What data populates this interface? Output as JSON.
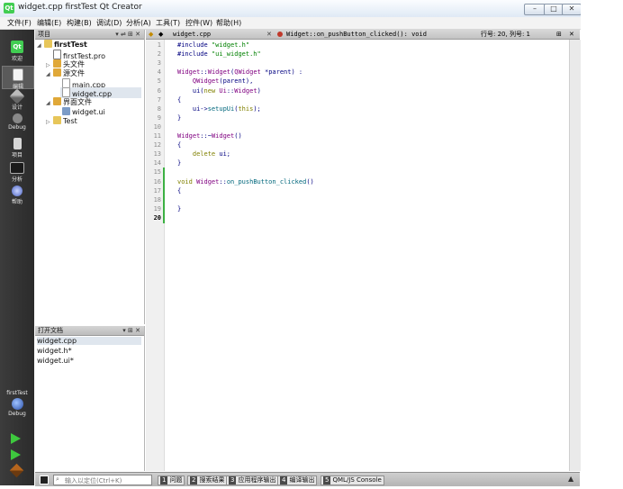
{
  "window": {
    "title": "widget.cpp   firstTest   Qt Creator",
    "app_icon": "Qt"
  },
  "menubar": [
    "文件(F)",
    "编辑(E)",
    "构建(B)",
    "调试(D)",
    "分析(A)",
    "工具(T)",
    "控件(W)",
    "帮助(H)"
  ],
  "modes": [
    {
      "label": "欢迎",
      "icon": "qt-logo-icon"
    },
    {
      "label": "编辑",
      "icon": "edit-document-icon"
    },
    {
      "label": "设计",
      "icon": "design-pen-icon"
    },
    {
      "label": "Debug",
      "icon": "debug-bug-icon"
    },
    {
      "label": "项目",
      "icon": "project-wrench-icon"
    },
    {
      "label": "分析",
      "icon": "analyze-monitor-icon"
    },
    {
      "label": "帮助",
      "icon": "help-icon"
    }
  ],
  "kit": {
    "project": "firstTest",
    "build": "Debug"
  },
  "project_panel": {
    "header": "项目",
    "tree": [
      {
        "label": "firstTest",
        "level": 0,
        "expanded": true,
        "icon": "project-folder-icon",
        "bold": true
      },
      {
        "label": "firstTest.pro",
        "level": 1,
        "icon": "pro-file-icon"
      },
      {
        "label": "头文件",
        "level": 1,
        "expanded": false,
        "icon": "headers-folder-icon"
      },
      {
        "label": "源文件",
        "level": 1,
        "expanded": true,
        "icon": "sources-folder-icon"
      },
      {
        "label": "main.cpp",
        "level": 2,
        "icon": "cpp-file-icon"
      },
      {
        "label": "widget.cpp",
        "level": 2,
        "icon": "cpp-file-icon",
        "selected": true
      },
      {
        "label": "界面文件",
        "level": 1,
        "expanded": true,
        "icon": "forms-folder-icon"
      },
      {
        "label": "widget.ui",
        "level": 2,
        "icon": "ui-file-icon"
      },
      {
        "label": "Test",
        "level": 0,
        "expanded": false,
        "icon": "project-folder-icon"
      }
    ]
  },
  "open_docs": {
    "header": "打开文档",
    "items": [
      "widget.cpp",
      "widget.h*",
      "widget.ui*"
    ]
  },
  "editor_toolbar": {
    "file": "widget.cpp",
    "symbol": "Widget::on_pushButton_clicked(): void",
    "position": "行号: 20, 列号: 1"
  },
  "code": [
    {
      "n": "1",
      "text": "#include \"widget.h\""
    },
    {
      "n": "2",
      "text": "#include \"ui_widget.h\""
    },
    {
      "n": "3",
      "text": ""
    },
    {
      "n": "4",
      "text": "Widget::Widget(QWidget *parent) :"
    },
    {
      "n": "5",
      "text": "    QWidget(parent),"
    },
    {
      "n": "6",
      "text": "    ui(new Ui::Widget)"
    },
    {
      "n": "7",
      "text": "{"
    },
    {
      "n": "8",
      "text": "    ui->setupUi(this);"
    },
    {
      "n": "9",
      "text": "}"
    },
    {
      "n": "10",
      "text": ""
    },
    {
      "n": "11",
      "text": "Widget::~Widget()"
    },
    {
      "n": "12",
      "text": "{"
    },
    {
      "n": "13",
      "text": "    delete ui;"
    },
    {
      "n": "14",
      "text": "}"
    },
    {
      "n": "15",
      "text": ""
    },
    {
      "n": "16",
      "text": "void Widget::on_pushButton_clicked()"
    },
    {
      "n": "17",
      "text": "{"
    },
    {
      "n": "18",
      "text": ""
    },
    {
      "n": "19",
      "text": "}"
    },
    {
      "n": "20",
      "text": ""
    }
  ],
  "statusbar": {
    "locator_placeholder": "输入以定位(Ctrl+K)",
    "tabs": [
      {
        "num": "1",
        "label": "问题"
      },
      {
        "num": "2",
        "label": "搜索结果"
      },
      {
        "num": "3",
        "label": "应用程序输出"
      },
      {
        "num": "4",
        "label": "编译输出"
      },
      {
        "num": "5",
        "label": "QML/JS Console"
      }
    ]
  },
  "colors": {
    "mode_bar": "#2f2f2f",
    "keyword": "#808000",
    "string": "#008000",
    "class": "#800080",
    "line_numbers": "#8c8c8c"
  }
}
